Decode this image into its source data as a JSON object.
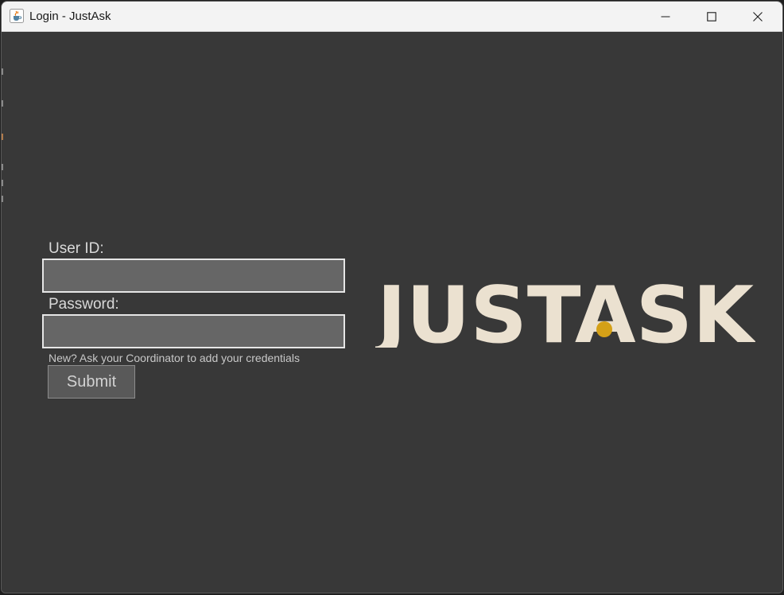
{
  "window": {
    "title": "Login - JustAsk",
    "icon": "java-cup-icon",
    "controls": [
      "minimize-icon",
      "maximize-icon",
      "close-icon"
    ]
  },
  "form": {
    "userid_label": "User ID:",
    "userid_value": "",
    "password_label": "Password:",
    "password_value": "",
    "hint": "New? Ask your Coordinator to add your credentials",
    "submit_label": "Submit"
  },
  "logo": {
    "text": "JUSTASK",
    "text_color": "#ebe1d0",
    "dot_color": "#d4a017"
  },
  "colors": {
    "background": "#383838",
    "field_fill": "#666666",
    "field_border": "#e6e6e6",
    "button_fill": "#595959"
  }
}
